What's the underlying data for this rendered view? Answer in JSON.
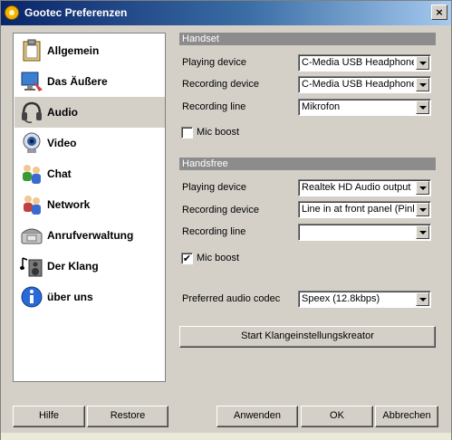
{
  "window": {
    "title": "Gootec Preferenzen",
    "close_label": "×"
  },
  "nav": {
    "items": [
      {
        "label": "Allgemein",
        "icon": "clipboard-icon"
      },
      {
        "label": "Das Äußere",
        "icon": "monitor-icon"
      },
      {
        "label": "Audio",
        "icon": "headset-icon",
        "selected": true
      },
      {
        "label": "Video",
        "icon": "webcam-icon"
      },
      {
        "label": "Chat",
        "icon": "chat-users-icon"
      },
      {
        "label": "Network",
        "icon": "network-icon"
      },
      {
        "label": "Anrufverwaltung",
        "icon": "phone-icon"
      },
      {
        "label": "Der Klang",
        "icon": "speaker-music-icon"
      },
      {
        "label": "über uns",
        "icon": "info-icon"
      }
    ]
  },
  "handset": {
    "header": "Handset",
    "playing_label": "Playing device",
    "playing_value": "C-Media USB Headphone",
    "recording_label": "Recording device",
    "recording_value": "C-Media USB Headphone",
    "line_label": "Recording line",
    "line_value": "Mikrofon",
    "mic_boost_label": "Mic boost",
    "mic_boost_checked": false
  },
  "handsfree": {
    "header": "Handsfree",
    "playing_label": "Playing device",
    "playing_value": "Realtek HD Audio output",
    "recording_label": "Recording device",
    "recording_value": "Line in at front panel (Pink)",
    "line_label": "Recording line",
    "line_value": "",
    "mic_boost_label": "Mic boost",
    "mic_boost_checked": true
  },
  "codec": {
    "label": "Preferred audio codec",
    "value": "Speex (12.8kbps)"
  },
  "wizard_button": "Start Klangeinstellungskreator",
  "buttons": {
    "help": "Hilfe",
    "restore": "Restore",
    "apply": "Anwenden",
    "ok": "OK",
    "cancel": "Abbrechen"
  },
  "colors": {
    "titlebar_start": "#0a246a",
    "titlebar_end": "#a6caf0",
    "face": "#d4d0c8",
    "section_header": "#8c8c8c"
  }
}
